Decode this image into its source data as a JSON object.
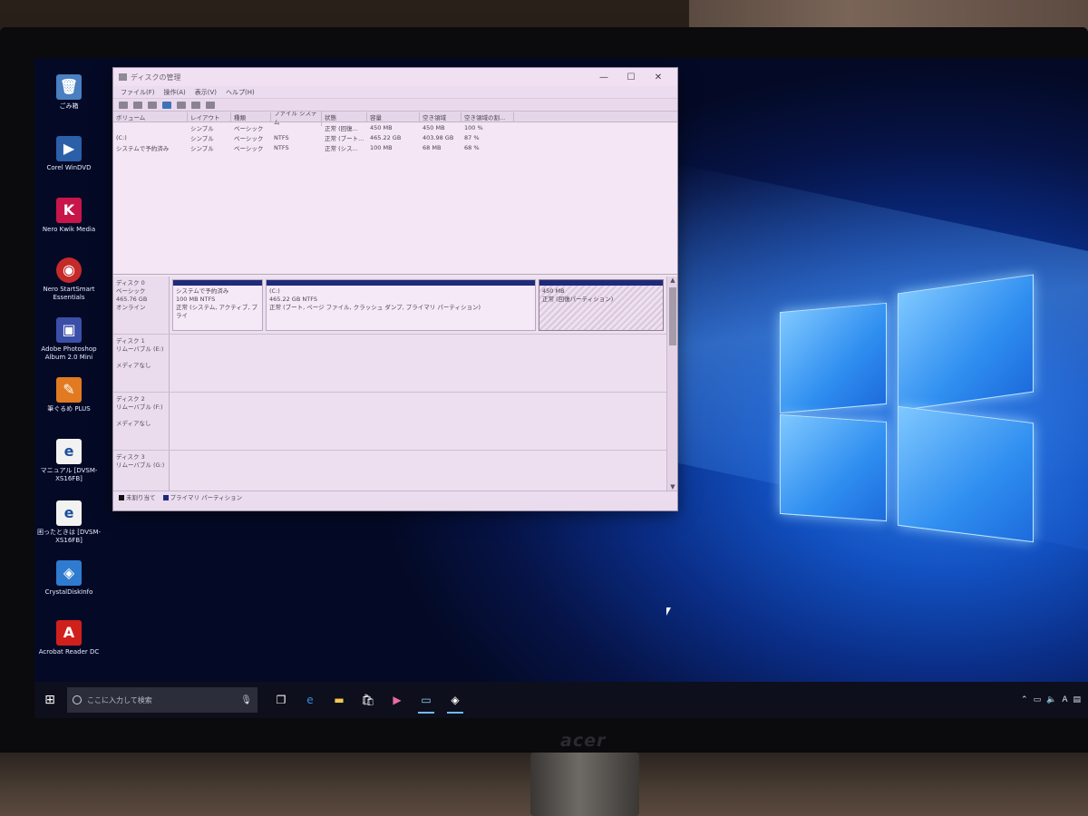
{
  "monitor": {
    "brand": "acer"
  },
  "desktop_icons": [
    {
      "label": "ごみ箱",
      "icon": "recycle-bin-icon",
      "color": "#4a7fc0"
    },
    {
      "label": "Corel WinDVD",
      "icon": "windvd-icon",
      "color": "#2b5fa8"
    },
    {
      "label": "Nero Kwik Media",
      "icon": "nero-kwik-icon",
      "color": "#c8164a"
    },
    {
      "label": "Nero StartSmart Essentials",
      "icon": "nero-startsmart-icon",
      "color": "#c52a2a"
    },
    {
      "label": "Adobe Photoshop Album 2.0 Mini",
      "icon": "photoshop-album-icon",
      "color": "#3b4fa8"
    },
    {
      "label": "筆ぐるめ PLUS",
      "icon": "fudegurume-icon",
      "color": "#e27a22"
    },
    {
      "label": "マニュアル [DVSM-XS16FB]",
      "icon": "pdf-manual-icon",
      "color": "#f2f2f2"
    },
    {
      "label": "困ったときは [DVSM-XS16FB]",
      "icon": "pdf-help-icon",
      "color": "#f2f2f2"
    },
    {
      "label": "CrystalDiskInfo",
      "icon": "crystaldiskinfo-icon",
      "color": "#2f7bd0"
    },
    {
      "label": "Acrobat Reader DC",
      "icon": "acrobat-icon",
      "color": "#d0201c"
    }
  ],
  "window": {
    "title": "ディスクの管理",
    "menu": [
      "ファイル(F)",
      "操作(A)",
      "表示(V)",
      "ヘルプ(H)"
    ],
    "columns": [
      "ボリューム",
      "レイアウト",
      "種類",
      "ファイル システム",
      "状態",
      "容量",
      "空き領域",
      "空き領域の割..."
    ],
    "volumes": [
      {
        "name": "",
        "layout": "シンプル",
        "type": "ベーシック",
        "fs": "",
        "status": "正常 (回復...",
        "capacity": "450 MB",
        "free": "450 MB",
        "pct": "100 %"
      },
      {
        "name": "(C:)",
        "layout": "シンプル",
        "type": "ベーシック",
        "fs": "NTFS",
        "status": "正常 (ブート...",
        "capacity": "465.22 GB",
        "free": "403.98 GB",
        "pct": "87 %"
      },
      {
        "name": "システムで予約済み",
        "layout": "シンプル",
        "type": "ベーシック",
        "fs": "NTFS",
        "status": "正常 (シス...",
        "capacity": "100 MB",
        "free": "68 MB",
        "pct": "68 %"
      }
    ],
    "disks": [
      {
        "name": "ディスク 0",
        "type": "ベーシック",
        "size": "465.76 GB",
        "state": "オンライン",
        "partitions": [
          {
            "line1": "システムで予約済み",
            "line2": "100 MB NTFS",
            "line3": "正常 (システム, アクティブ, プライ"
          },
          {
            "line1": "(C:)",
            "line2": "465.22 GB NTFS",
            "line3": "正常 (ブート, ページ ファイル, クラッシュ ダンプ, プライマリ パーティション)"
          },
          {
            "line1": "",
            "line2": "450 MB",
            "line3": "正常 (回復パーティション)"
          }
        ]
      },
      {
        "name": "ディスク 1",
        "type": "リムーバブル (E:)",
        "size": "",
        "state": "メディアなし"
      },
      {
        "name": "ディスク 2",
        "type": "リムーバブル (F:)",
        "size": "",
        "state": "メディアなし"
      },
      {
        "name": "ディスク 3",
        "type": "リムーバブル (G:)",
        "size": "",
        "state": ""
      }
    ],
    "legend": [
      {
        "label": "未割り当て",
        "color": "#111111"
      },
      {
        "label": "プライマリ パーティション",
        "color": "#1e2a7a"
      }
    ]
  },
  "taskbar": {
    "search_placeholder": "ここに入力して検索",
    "tray_ime": "A"
  }
}
